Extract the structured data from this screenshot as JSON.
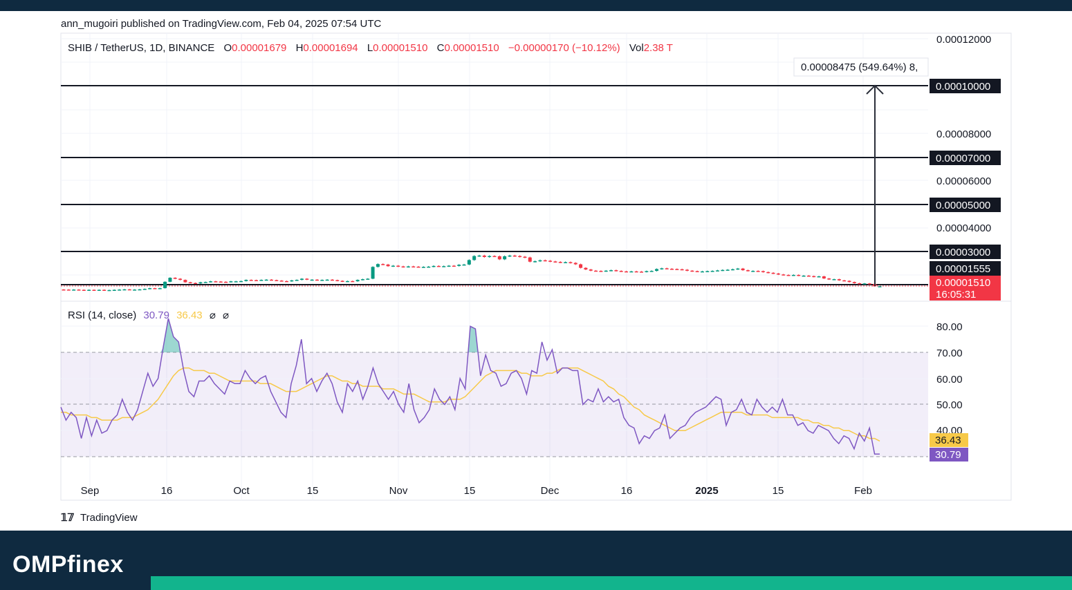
{
  "header": {
    "byline": "ann_mugoiri published on TradingView.com, Feb 04, 2025 07:54 UTC"
  },
  "legend": {
    "symbol": "SHIB / TetherUS, 1D, BINANCE",
    "o_label": "O",
    "o_value": "0.00001679",
    "h_label": "H",
    "h_value": "0.00001694",
    "l_label": "L",
    "l_value": "0.00001510",
    "c_label": "C",
    "c_value": "0.00001510",
    "change": "−0.00000170 (−10.12%)",
    "vol_label": "Vol",
    "vol_value": "2.38 T"
  },
  "measure_label": "0.00008475 (549.64%) 8,",
  "price_axis": {
    "ticks": [
      "0.00012000",
      "0.00008000",
      "0.00006000",
      "0.00004000"
    ],
    "level_badges": [
      "0.00010000",
      "0.00007000",
      "0.00005000",
      "0.00003000",
      "0.00001555"
    ],
    "current_price": "0.00001510",
    "countdown": "16:05:31"
  },
  "rsi": {
    "label": "RSI (14, close)",
    "rsi_value": "30.79",
    "ma_value": "36.43",
    "ticks": [
      "80.00",
      "70.00",
      "60.00",
      "50.00",
      "40.00"
    ],
    "rsi_color": "#7e57c2",
    "ma_color": "#f7c948",
    "rsi_points": [
      49,
      44,
      47,
      45,
      37,
      45,
      38,
      44,
      39,
      40,
      44,
      46,
      52,
      47,
      44,
      48,
      55,
      62,
      57,
      60,
      72,
      83,
      76,
      74,
      63,
      55,
      53,
      59,
      59,
      61,
      58,
      56,
      54,
      59,
      58,
      58,
      63,
      60,
      58,
      60,
      61,
      55,
      51,
      47,
      45,
      58,
      65,
      75,
      58,
      60,
      55,
      59,
      62,
      58,
      51,
      47,
      58,
      55,
      59,
      52,
      57,
      64,
      58,
      55,
      52,
      55,
      50,
      47,
      58,
      48,
      43,
      45,
      48,
      56,
      52,
      50,
      53,
      48,
      60,
      56,
      80,
      79,
      61,
      69,
      63,
      62,
      57,
      58,
      62,
      63,
      60,
      54,
      63,
      62,
      74,
      67,
      71,
      62,
      64,
      64,
      63,
      63,
      50,
      52,
      51,
      56,
      51,
      53,
      51,
      52,
      45,
      42,
      41,
      35,
      38,
      37,
      40,
      41,
      46,
      37,
      39,
      41,
      42,
      45,
      47,
      48,
      49,
      51,
      53,
      52,
      42,
      47,
      48,
      52,
      47,
      46,
      52,
      49,
      47,
      49,
      47,
      52,
      46,
      46,
      42,
      43,
      40,
      39,
      42,
      41,
      40,
      37,
      35,
      38,
      37,
      33,
      39,
      36,
      41,
      31,
      31
    ],
    "ma_points": [
      47,
      47,
      46,
      46,
      46,
      46,
      45,
      45,
      44,
      44,
      44,
      44,
      45,
      45,
      45,
      46,
      47,
      48,
      50,
      52,
      55,
      58,
      61,
      63,
      64,
      64,
      63,
      63,
      63,
      62,
      62,
      61,
      60,
      59,
      59,
      59,
      59,
      59,
      59,
      58,
      58,
      58,
      57,
      56,
      55,
      55,
      55,
      56,
      57,
      58,
      59,
      60,
      61,
      61,
      60,
      59,
      59,
      58,
      58,
      57,
      57,
      57,
      57,
      56,
      56,
      56,
      55,
      54,
      54,
      54,
      53,
      52,
      51,
      51,
      51,
      51,
      52,
      52,
      52,
      53,
      55,
      57,
      59,
      61,
      62,
      63,
      63,
      63,
      63,
      63,
      62,
      62,
      61,
      61,
      61,
      62,
      62,
      63,
      64,
      64,
      64,
      64,
      63,
      62,
      61,
      60,
      59,
      57,
      56,
      54,
      53,
      51,
      49,
      48,
      46,
      45,
      44,
      43,
      42,
      41,
      40,
      40,
      40,
      41,
      42,
      43,
      44,
      45,
      46,
      47,
      47,
      47,
      47,
      47,
      46,
      46,
      46,
      46,
      46,
      45,
      45,
      45,
      45,
      45,
      45,
      44,
      44,
      43,
      43,
      42,
      42,
      41,
      41,
      40,
      40,
      39,
      38,
      38,
      37,
      37,
      36
    ]
  },
  "chart_data": {
    "type": "candlestick",
    "symbol": "SHIB / TetherUS",
    "timeframe": "1D",
    "exchange": "BINANCE",
    "x_tick_labels": [
      "Sep",
      "16",
      "Oct",
      "15",
      "Nov",
      "15",
      "Dec",
      "16",
      "2025",
      "15",
      "Feb"
    ],
    "ylim": [
      3e-06,
      0.000122
    ],
    "horizontal_levels": [
      0.0001,
      7e-05,
      5e-05,
      3e-05,
      1.555e-05,
      1.51e-05
    ],
    "measure_from": 1.51e-05,
    "measure_to": 0.0001,
    "closes": [
      1.37e-05,
      1.36e-05,
      1.37e-05,
      1.36e-05,
      1.35e-05,
      1.36e-05,
      1.35e-05,
      1.36e-05,
      1.35e-05,
      1.35e-05,
      1.36e-05,
      1.37e-05,
      1.38e-05,
      1.37e-05,
      1.37e-05,
      1.38e-05,
      1.4e-05,
      1.43e-05,
      1.42e-05,
      1.43e-05,
      1.7e-05,
      1.87e-05,
      1.83e-05,
      1.78e-05,
      1.68e-05,
      1.65e-05,
      1.63e-05,
      1.68e-05,
      1.69e-05,
      1.72e-05,
      1.71e-05,
      1.7e-05,
      1.69e-05,
      1.72e-05,
      1.72e-05,
      1.73e-05,
      1.78e-05,
      1.77e-05,
      1.76e-05,
      1.78e-05,
      1.79e-05,
      1.77e-05,
      1.75e-05,
      1.73e-05,
      1.72e-05,
      1.76e-05,
      1.78e-05,
      1.83e-05,
      1.79e-05,
      1.79e-05,
      1.77e-05,
      1.78e-05,
      1.79e-05,
      1.77e-05,
      1.74e-05,
      1.71e-05,
      1.73e-05,
      1.72e-05,
      1.78e-05,
      1.81e-05,
      1.83e-05,
      2.33e-05,
      2.45e-05,
      2.43e-05,
      2.36e-05,
      2.38e-05,
      2.35e-05,
      2.33e-05,
      2.35e-05,
      2.34e-05,
      2.33e-05,
      2.33e-05,
      2.34e-05,
      2.37e-05,
      2.36e-05,
      2.36e-05,
      2.38e-05,
      2.37e-05,
      2.42e-05,
      2.43e-05,
      2.62e-05,
      2.79e-05,
      2.81e-05,
      2.75e-05,
      2.79e-05,
      2.78e-05,
      2.65e-05,
      2.78e-05,
      2.81e-05,
      2.79e-05,
      2.76e-05,
      2.73e-05,
      2.55e-05,
      2.57e-05,
      2.61e-05,
      2.59e-05,
      2.56e-05,
      2.54e-05,
      2.52e-05,
      2.53e-05,
      2.5e-05,
      2.44e-05,
      2.29e-05,
      2.22e-05,
      2.17e-05,
      2.16e-05,
      2.15e-05,
      2.17e-05,
      2.19e-05,
      2.16e-05,
      2.14e-05,
      2.13e-05,
      2.14e-05,
      2.13e-05,
      2.12e-05,
      2.15e-05,
      2.16e-05,
      2.24e-05,
      2.27e-05,
      2.25e-05,
      2.24e-05,
      2.23e-05,
      2.21e-05,
      2.17e-05,
      2.15e-05,
      2.14e-05,
      2.14e-05,
      2.15e-05,
      2.16e-05,
      2.18e-05,
      2.2e-05,
      2.21e-05,
      2.23e-05,
      2.26e-05,
      2.19e-05,
      2.16e-05,
      2.16e-05,
      2.15e-05,
      2.11e-05,
      2.08e-05,
      2.05e-05,
      2.01e-05,
      1.99e-05,
      1.97e-05,
      1.99e-05,
      1.96e-05,
      1.96e-05,
      1.94e-05,
      1.91e-05,
      1.93e-05,
      1.84e-05,
      1.8e-05,
      1.81e-05,
      1.76e-05,
      1.74e-05,
      1.69e-05,
      1.64e-05,
      1.61e-05,
      1.63e-05,
      1.61e-05,
      1.51e-05,
      1.51e-05
    ]
  }
}
